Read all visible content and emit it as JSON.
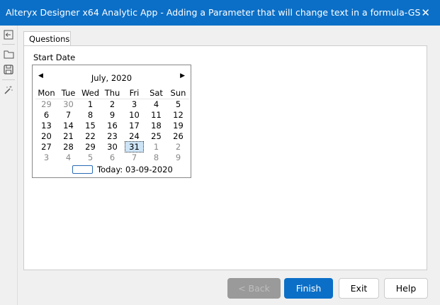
{
  "window": {
    "title": "Alteryx Designer x64 Analytic App - Adding a Parameter that will change text in a formula-GS",
    "close_glyph": "✕"
  },
  "toolbar": [
    {
      "icon": "back-arrow-icon"
    },
    {
      "icon": "folder-icon"
    },
    {
      "icon": "save-icon"
    },
    {
      "icon": "magic-wand-icon"
    }
  ],
  "tabs": [
    {
      "label": "Questions"
    }
  ],
  "question": {
    "label": "Start Date"
  },
  "calendar": {
    "month_label": "July, 2020",
    "weekdays": [
      "Mon",
      "Tue",
      "Wed",
      "Thu",
      "Fri",
      "Sat",
      "Sun"
    ],
    "weeks": [
      [
        "29",
        "30",
        "1",
        "2",
        "3",
        "4",
        "5"
      ],
      [
        "6",
        "7",
        "8",
        "9",
        "10",
        "11",
        "12"
      ],
      [
        "13",
        "14",
        "15",
        "16",
        "17",
        "18",
        "19"
      ],
      [
        "20",
        "21",
        "22",
        "23",
        "24",
        "25",
        "26"
      ],
      [
        "27",
        "28",
        "29",
        "30",
        "31",
        "1",
        "2"
      ],
      [
        "3",
        "4",
        "5",
        "6",
        "7",
        "8",
        "9"
      ]
    ],
    "selected": "31",
    "today_label": "Today: 03-09-2020"
  },
  "buttons": {
    "back": "< Back",
    "finish": "Finish",
    "exit": "Exit",
    "help": "Help"
  }
}
